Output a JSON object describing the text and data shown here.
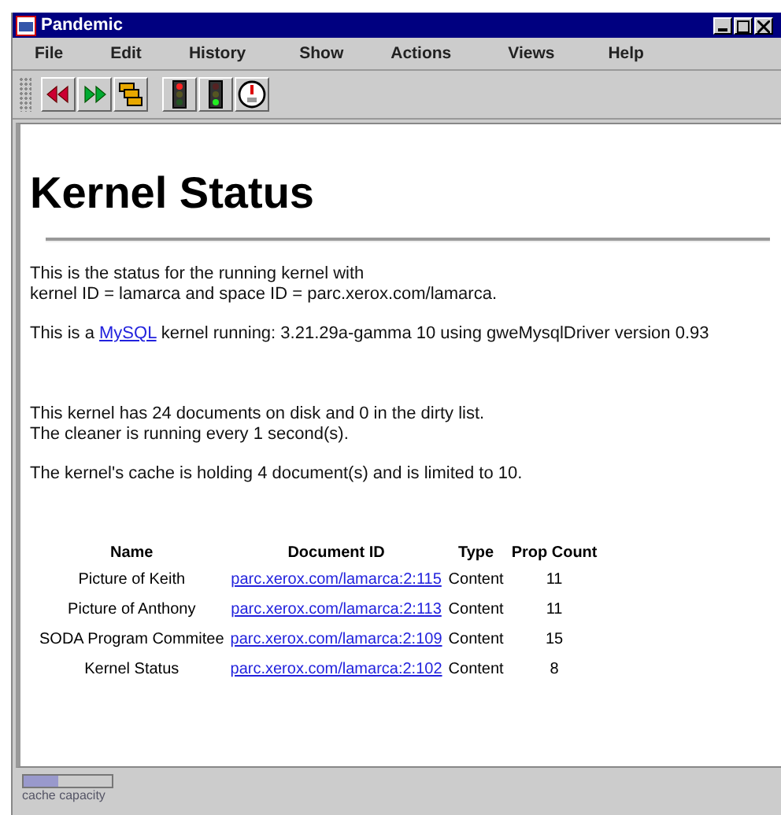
{
  "window": {
    "title": "Pandemic"
  },
  "menu": [
    "File",
    "Edit",
    "History",
    "Show",
    "Actions",
    "Views",
    "Help"
  ],
  "toolbar": [
    {
      "kind": "back"
    },
    {
      "kind": "forward"
    },
    {
      "kind": "stack"
    },
    {
      "kind": "stoplight-red"
    },
    {
      "kind": "stoplight-green"
    },
    {
      "kind": "gauge"
    }
  ],
  "heading": "Kernel Status",
  "paragraphs": [
    {
      "lines": [
        "This is the status for the running kernel with",
        "kernel ID = lamarca and space ID = parc.xerox.com/lamarca."
      ]
    },
    {
      "before": "This is a ",
      "link": "MySQL",
      "after": " kernel running: 3.21.29a-gamma 10 using gweMysqlDriver version 0.93"
    },
    {
      "lines": [
        "This kernel has 24 documents on disk and 0 in the dirty list.",
        "The cleaner is running every 1 second(s)."
      ]
    },
    {
      "lines": [
        "The kernel's cache is holding 4 document(s) and is limited to 10."
      ]
    }
  ],
  "table": {
    "columns": [
      "Name",
      "Document ID",
      "Type",
      "Prop Count"
    ],
    "rows": [
      [
        "Picture of Keith",
        "parc.xerox.com/lamarca:2:115",
        "Content",
        "11"
      ],
      [
        "Picture of Anthony",
        "parc.xerox.com/lamarca:2:113",
        "Content",
        "11"
      ],
      [
        "SODA Program Commitee",
        "parc.xerox.com/lamarca:2:109",
        "Content",
        "15"
      ],
      [
        "Kernel Status",
        "parc.xerox.com/lamarca:2:102",
        "Content",
        "8"
      ]
    ]
  },
  "status_bar": {
    "cache_meter": {
      "level": 0.4,
      "label": "cache capacity"
    }
  }
}
